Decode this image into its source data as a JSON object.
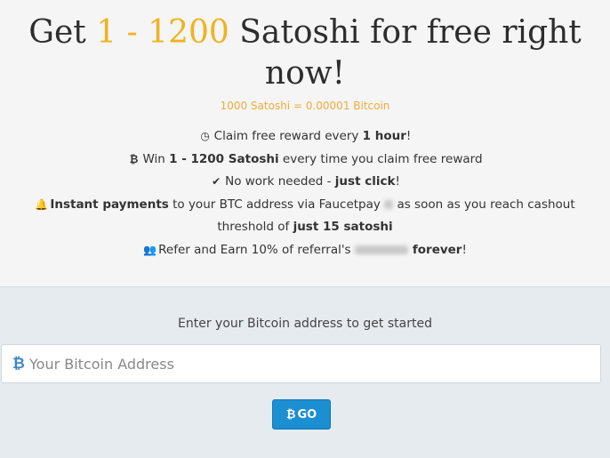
{
  "hero": {
    "title_prefix": "Get ",
    "title_highlight": "1 - 1200",
    "title_suffix": " Satoshi for free right now!",
    "rate": "1000 Satoshi = 0.00001 Bitcoin",
    "features": [
      {
        "icon": "clock-icon",
        "pre": "Claim free reward every ",
        "bold": "1 hour",
        "post": "!"
      },
      {
        "icon": "bitcoin-icon",
        "pre": "Win ",
        "bold": "1 - 1200 Satoshi",
        "post": " every time you claim free reward"
      },
      {
        "icon": "check-icon",
        "pre": "No work needed - ",
        "bold": "just click",
        "post": "!"
      },
      {
        "icon": "bell-icon",
        "bold_start": "Instant payments",
        "text_a": " to your BTC address via Faucetpay ",
        "text_b": " as soon as you reach cashout threshold of ",
        "bold_end": "just 15 satoshi"
      },
      {
        "icon": "users-icon",
        "pre": "Refer and Earn 10% of referral's ",
        "bold": "forever",
        "post": "!"
      }
    ]
  },
  "form": {
    "prompt": "Enter your Bitcoin address to get started",
    "address_placeholder": "Your Bitcoin Address",
    "address_value": "",
    "go_label": "GO"
  },
  "colors": {
    "accent": "#f0b21e",
    "rate": "#f0ab3c",
    "button": "#1c8ed2",
    "form_bg": "#e6ebf0"
  }
}
